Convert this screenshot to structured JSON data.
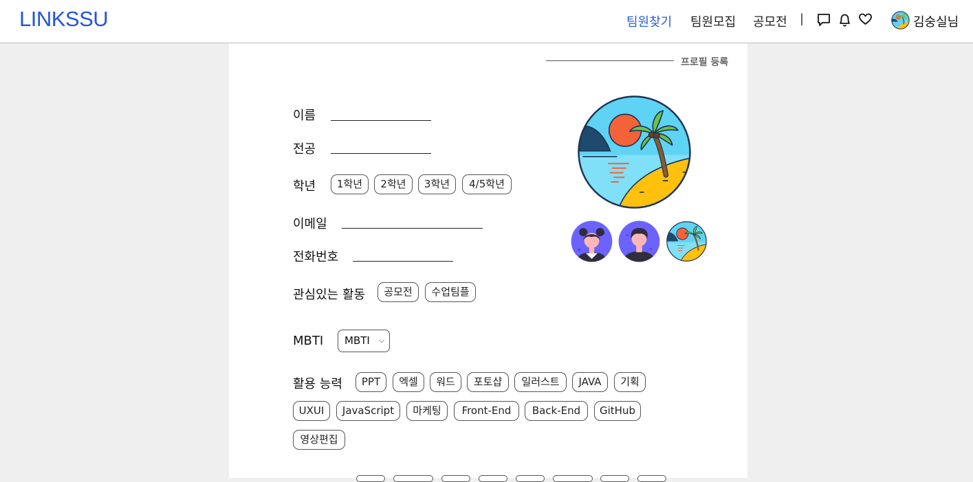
{
  "header": {
    "logo": "LINKSSU",
    "nav": [
      "팀원찾기",
      "팀원모집",
      "공모전"
    ],
    "active_nav": "팀원찾기",
    "separator": "|",
    "icons": [
      "chat-icon",
      "bell-icon",
      "heart-icon"
    ],
    "username": "김숭실님"
  },
  "form": {
    "section_title": "프로필 등록",
    "name_label": "이름",
    "major_label": "전공",
    "grade_label": "학년",
    "grades": [
      "1학년",
      "2학년",
      "3학년",
      "4/5학년"
    ],
    "email_label": "이메일",
    "phone_label": "전화번호",
    "interest_label": "관심있는 활동",
    "interests": [
      "공모전",
      "수업팀플"
    ],
    "mbti_label": "MBTI",
    "mbti_value": "MBTI",
    "skills_label": "활용 능력",
    "skills": [
      "PPT",
      "엑셀",
      "워드",
      "포토샵",
      "일러스트",
      "JAVA",
      "기획",
      "UXUI",
      "JavaScript",
      "마케팅",
      "Front-End",
      "Back-End",
      "GitHub",
      "영상편집"
    ]
  },
  "avatars": {
    "selected": "beach-avatar",
    "options": [
      "girl-avatar",
      "boy-avatar",
      "beach-avatar"
    ]
  },
  "colors": {
    "brand": "#2255d9",
    "avatar_purple": "#6c63ff",
    "sky": "#5fd3f3",
    "sun": "#f4623a",
    "sand": "#ffc10e"
  }
}
